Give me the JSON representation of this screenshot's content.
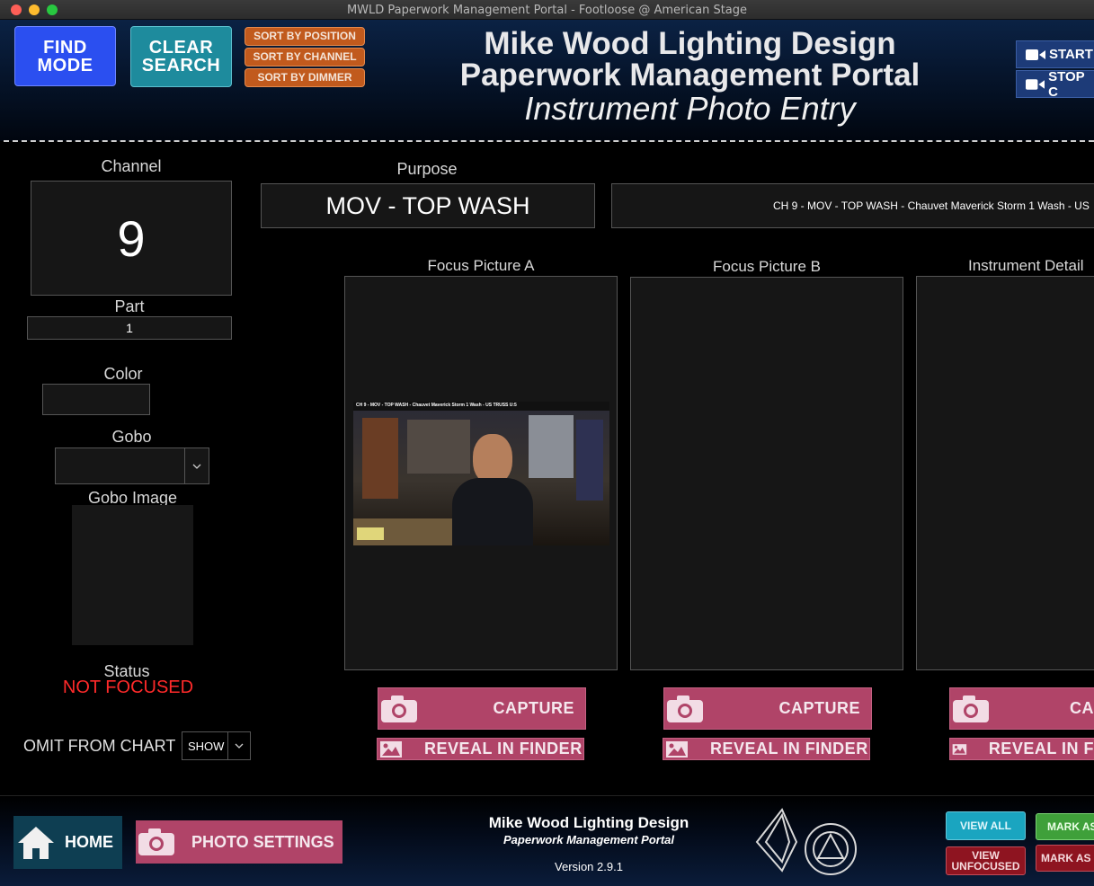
{
  "window": {
    "title": "MWLD Paperwork Management Portal - Footloose @ American Stage"
  },
  "header": {
    "find_mode": "FIND MODE",
    "clear_search": "CLEAR SEARCH",
    "sort_by_position": "SORT BY POSITION",
    "sort_by_channel": "SORT BY CHANNEL",
    "sort_by_dimmer": "SORT BY DIMMER",
    "title_line1": "Mike Wood Lighting Design",
    "title_line2": "Paperwork Management Portal",
    "subtitle": "Instrument Photo Entry",
    "start_button": "START",
    "stop_button": "STOP C"
  },
  "form": {
    "channel_label": "Channel",
    "channel_value": "9",
    "part_label": "Part",
    "part_value": "1",
    "color_label": "Color",
    "color_value": "",
    "gobo_label": "Gobo",
    "gobo_value": "",
    "gobo_image_label": "Gobo Image",
    "status_label": "Status",
    "status_value": "NOT FOCUSED",
    "omit_label": "OMIT FROM CHART",
    "omit_value": "SHOW",
    "purpose_label": "Purpose",
    "purpose_value": "MOV - TOP WASH",
    "description_value": "CH 9 - MOV - TOP WASH - Chauvet Maverick Storm 1 Wash - US"
  },
  "photos": {
    "focus_a_label": "Focus Picture A",
    "focus_b_label": "Focus Picture B",
    "detail_label": "Instrument Detail",
    "overlay_caption": "CH 9 - MOV - TOP WASH - Chauvet Maverick Storm 1 Wash - US TRUSS U:5",
    "capture_label": "CAPTURE",
    "capture_label_cut": "CA",
    "reveal_label": "REVEAL IN FINDER",
    "reveal_label_cut": "REVEAL IN F"
  },
  "footer": {
    "home": "HOME",
    "photo_settings": "PHOTO SETTINGS",
    "company": "Mike Wood Lighting Design",
    "portal": "Paperwork Management Portal",
    "version": "Version 2.9.1",
    "view_all": "VIEW ALL",
    "view_unfocused": "VIEW UNFOCUSED",
    "mark_as_1": "MARK AS",
    "mark_as_2": "MARK AS"
  },
  "colors": {
    "status_red": "#ff2a2a",
    "capture_pink": "#b04468",
    "find_blue": "#2a4fe6",
    "clear_teal": "#1e8a9c",
    "sort_orange": "#c15a1d",
    "home_teal": "#0e3e52"
  },
  "icons": [
    "camera-icon",
    "image-icon",
    "home-icon",
    "video-camera-icon",
    "chevron-down-icon"
  ]
}
